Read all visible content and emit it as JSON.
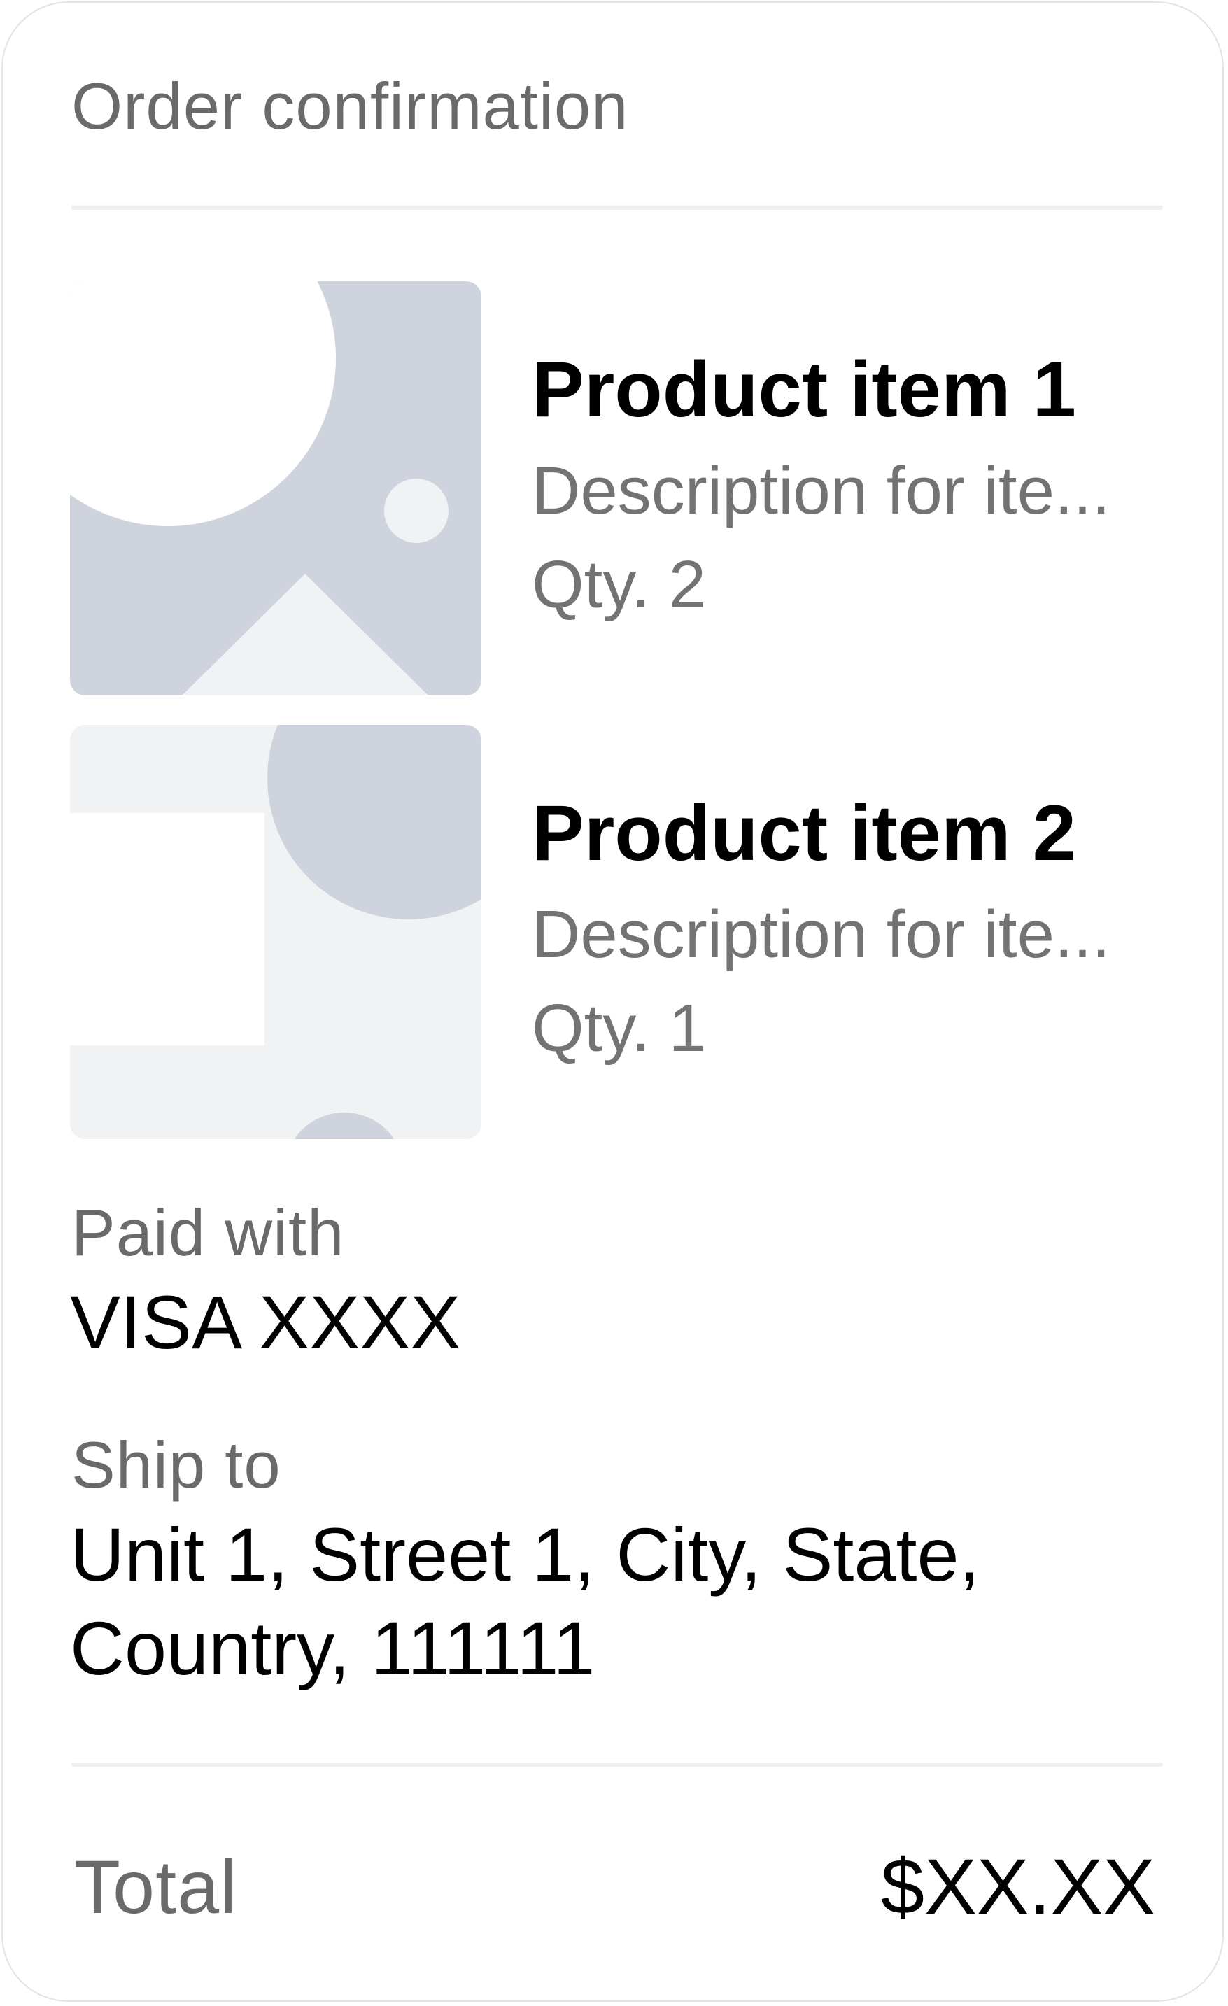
{
  "header": {
    "title": "Order confirmation"
  },
  "products": [
    {
      "name": "Product item 1",
      "description": "Description for ite...",
      "quantity": "Qty. 2",
      "thumbnail_icon": "image-placeholder-icon"
    },
    {
      "name": "Product item 2",
      "description": "Description for ite...",
      "quantity": "Qty. 1",
      "thumbnail_icon": "image-placeholder-icon"
    }
  ],
  "payment": {
    "label": "Paid with",
    "value": "VISA XXXX"
  },
  "shipping": {
    "label": "Ship to",
    "address_line1": "Unit 1, Street 1, City, State,",
    "address_line2": "Country, 111111"
  },
  "total": {
    "label": "Total",
    "value": "$XX.XX"
  },
  "colors": {
    "placeholder_dark": "#cfd3dd",
    "placeholder_light": "#f1f2f4",
    "muted_text": "#6a6a6a",
    "divider": "#efefef"
  }
}
